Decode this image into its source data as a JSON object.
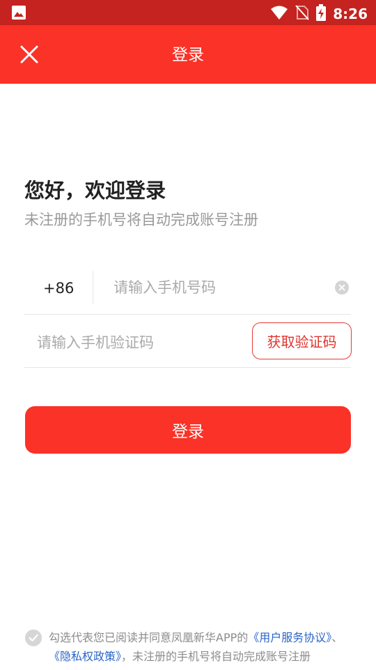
{
  "status_bar": {
    "time": "8:26",
    "icons": [
      "image-icon",
      "wifi-icon",
      "no-sim-icon",
      "battery-charging-icon"
    ]
  },
  "app_bar": {
    "close_icon": "close-icon",
    "title": "登录"
  },
  "greeting": {
    "title": "您好，欢迎登录",
    "subtitle": "未注册的手机号将自动完成账号注册"
  },
  "phone": {
    "country_code": "+86",
    "placeholder": "请输入手机号码",
    "value": ""
  },
  "code": {
    "placeholder": "请输入手机验证码",
    "value": "",
    "get_code_label": "获取验证码"
  },
  "login_button": "登录",
  "agreement": {
    "prefix": "勾选代表您已阅读并同意凤凰新华APP的",
    "user_agreement": "《用户服务协议》",
    "separator": "、",
    "privacy_policy": "《隐私权政策》",
    "suffix": "，未注册的手机号将自动完成账号注册"
  },
  "colors": {
    "status_bar": "#c4231f",
    "brand_red": "#fb3227",
    "link_blue": "#2a64c7"
  }
}
